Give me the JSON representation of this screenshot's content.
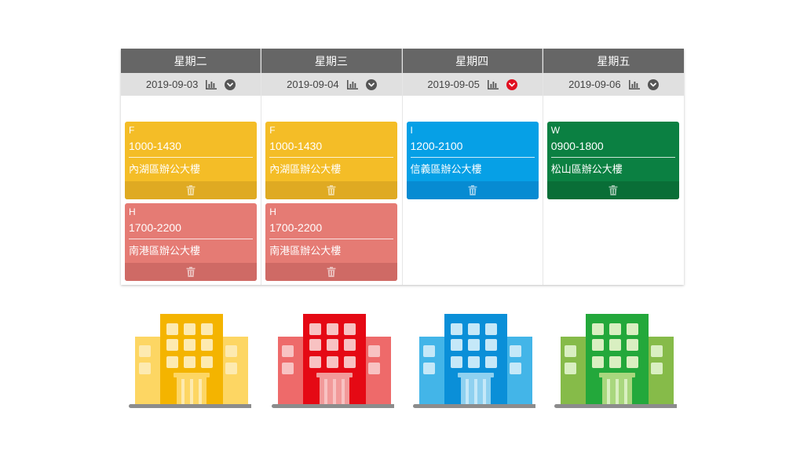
{
  "colors": {
    "header_bg": "#666666",
    "date_bg": "#e0e0e0",
    "yellow": "#f4bd27",
    "yellow_foot": "#dfaa22",
    "pink": "#e57b74",
    "pink_foot": "#cf6a65",
    "blue": "#06a0e6",
    "blue_foot": "#078bd2",
    "green": "#0b8042",
    "green_foot": "#096e37",
    "active_chevron": "#e01020"
  },
  "days": [
    {
      "weekday": "星期二",
      "date": "2019-09-03",
      "chart_icon": "bar-chart-icon",
      "chevron_icon": "chevron-down-icon",
      "active": false,
      "shifts": [
        {
          "code": "F",
          "time": "1000-1430",
          "place": "內湖區辦公大樓",
          "color": "#f4bd27",
          "foot": "#dfaa22"
        },
        {
          "code": "H",
          "time": "1700-2200",
          "place": "南港區辦公大樓",
          "color": "#e57b74",
          "foot": "#cf6a65"
        }
      ]
    },
    {
      "weekday": "星期三",
      "date": "2019-09-04",
      "chart_icon": "bar-chart-icon",
      "chevron_icon": "chevron-down-icon",
      "active": false,
      "shifts": [
        {
          "code": "F",
          "time": "1000-1430",
          "place": "內湖區辦公大樓",
          "color": "#f4bd27",
          "foot": "#dfaa22"
        },
        {
          "code": "H",
          "time": "1700-2200",
          "place": "南港區辦公大樓",
          "color": "#e57b74",
          "foot": "#cf6a65"
        }
      ]
    },
    {
      "weekday": "星期四",
      "date": "2019-09-05",
      "chart_icon": "bar-chart-icon",
      "chevron_icon": "chevron-down-icon",
      "active": true,
      "shifts": [
        {
          "code": "I",
          "time": "1200-2100",
          "place": "信義區辦公大樓",
          "color": "#06a0e6",
          "foot": "#078bd2"
        }
      ]
    },
    {
      "weekday": "星期五",
      "date": "2019-09-06",
      "chart_icon": "bar-chart-icon",
      "chevron_icon": "chevron-down-icon",
      "active": false,
      "shifts": [
        {
          "code": "W",
          "time": "0900-1800",
          "place": "松山區辦公大樓",
          "color": "#0b8042",
          "foot": "#096e37"
        }
      ]
    }
  ],
  "buildings": [
    {
      "icon": "office-building-icon",
      "side": "#fdd663",
      "main": "#f4b400",
      "window": "#fdeab0",
      "door": "#fdd663"
    },
    {
      "icon": "office-building-icon",
      "side": "#ee6a6a",
      "main": "#e50914",
      "window": "#f8c2c2",
      "door": "#f29a9a"
    },
    {
      "icon": "office-building-icon",
      "side": "#43b5e8",
      "main": "#0a8fd8",
      "window": "#c5e8f8",
      "door": "#8fd1f0"
    },
    {
      "icon": "office-building-icon",
      "side": "#86bb49",
      "main": "#23a83b",
      "window": "#d9efc1",
      "door": "#a9d77e"
    }
  ]
}
